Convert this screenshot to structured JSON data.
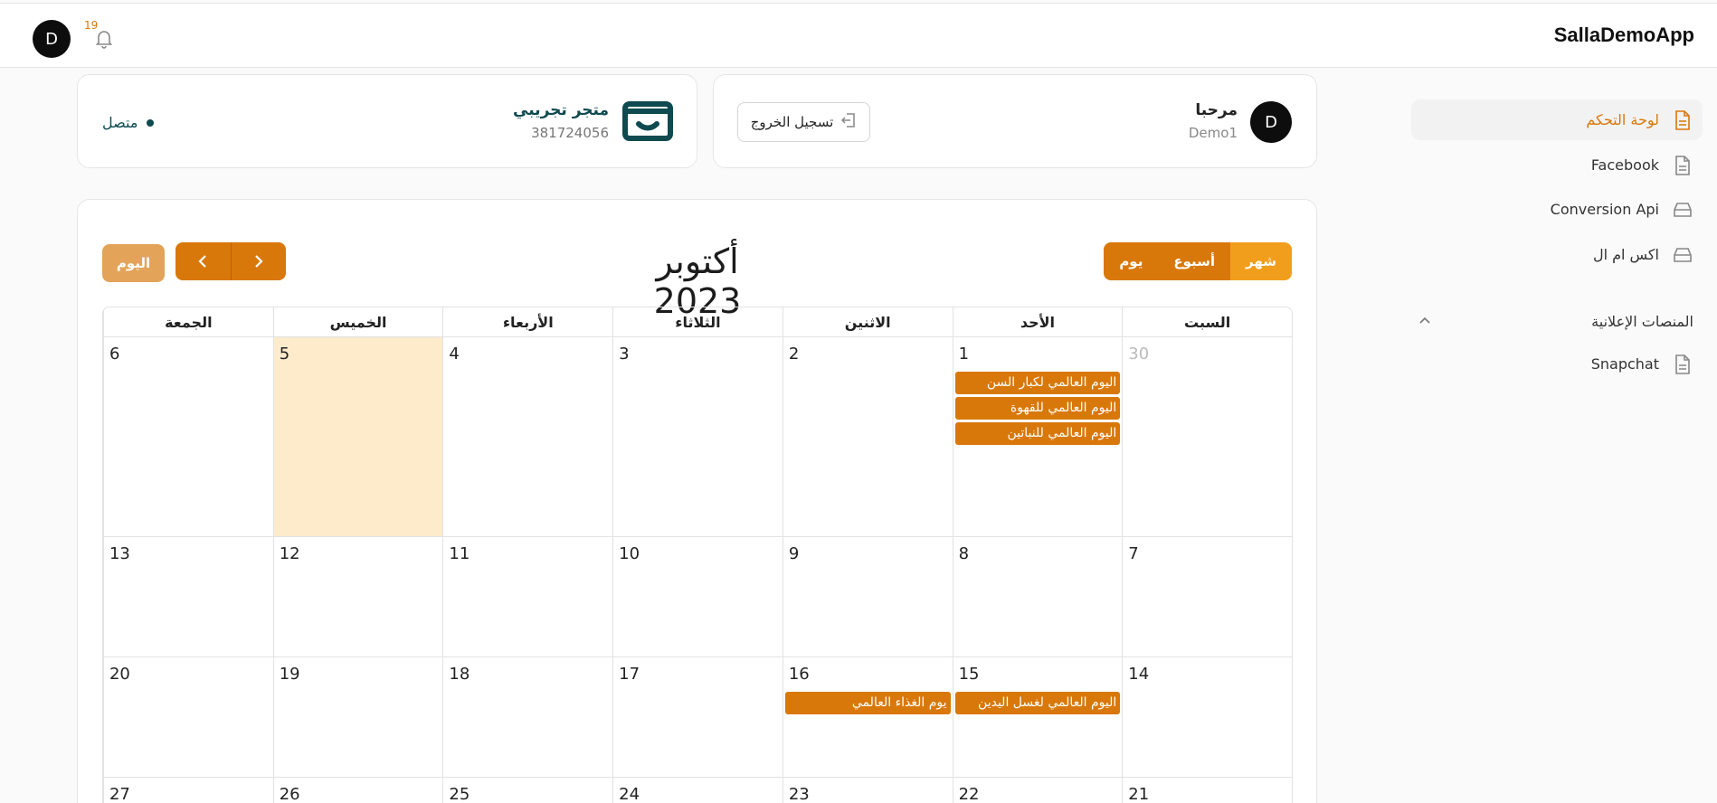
{
  "app": {
    "title": "SallaDemoApp",
    "avatar_letter": "D",
    "notifications_count": "19"
  },
  "sidebar": {
    "items": [
      {
        "label": "لوحة التحكم",
        "icon": "document-icon",
        "active": true
      },
      {
        "label": "Facebook",
        "icon": "document-icon",
        "active": false
      },
      {
        "label": "Conversion Api",
        "icon": "tray-icon",
        "active": false
      },
      {
        "label": "اكس ام ال",
        "icon": "tray-icon",
        "active": false
      }
    ],
    "section": {
      "label": "المنصات الإعلانية",
      "icon": "chevron-up-icon"
    },
    "section_items": [
      {
        "label": "Snapchat",
        "icon": "document-icon"
      }
    ]
  },
  "user_card": {
    "greeting": "مرحبا",
    "name": "Demo1",
    "avatar_letter": "D",
    "logout_label": "تسجيل الخروج"
  },
  "store_card": {
    "name": "متجر تجريبي",
    "id": "381724056",
    "status": "متصل"
  },
  "calendar": {
    "title": "أكتوبر 2023",
    "views": [
      "شهر",
      "أسبوع",
      "يوم"
    ],
    "active_view": "شهر",
    "today_label": "اليوم",
    "weekdays": [
      "السبت",
      "الأحد",
      "الاثنين",
      "الثلاثاء",
      "الأربعاء",
      "الخميس",
      "الجمعة"
    ],
    "weeks": [
      {
        "days": [
          {
            "num": "30",
            "muted": true,
            "events": []
          },
          {
            "num": "1",
            "events": [
              "اليوم العالمي لكبار السن",
              "اليوم العالمي للقهوة",
              "اليوم العالمي للنباتين"
            ]
          },
          {
            "num": "2",
            "events": []
          },
          {
            "num": "3",
            "events": []
          },
          {
            "num": "4",
            "events": []
          },
          {
            "num": "5",
            "today": true,
            "events": []
          },
          {
            "num": "6",
            "events": []
          }
        ]
      },
      {
        "days": [
          {
            "num": "7",
            "events": []
          },
          {
            "num": "8",
            "events": []
          },
          {
            "num": "9",
            "events": []
          },
          {
            "num": "10",
            "events": []
          },
          {
            "num": "11",
            "events": []
          },
          {
            "num": "12",
            "events": []
          },
          {
            "num": "13",
            "events": []
          }
        ]
      },
      {
        "days": [
          {
            "num": "14",
            "events": []
          },
          {
            "num": "15",
            "events": [
              "اليوم العالمي لغسل اليدين"
            ]
          },
          {
            "num": "16",
            "events": [
              "يوم الغذاء العالمي"
            ]
          },
          {
            "num": "17",
            "events": []
          },
          {
            "num": "18",
            "events": []
          },
          {
            "num": "19",
            "events": []
          },
          {
            "num": "20",
            "events": []
          }
        ]
      },
      {
        "days": [
          {
            "num": "21",
            "events": []
          },
          {
            "num": "22",
            "events": []
          },
          {
            "num": "23",
            "events": []
          },
          {
            "num": "24",
            "events": []
          },
          {
            "num": "25",
            "events": []
          },
          {
            "num": "26",
            "events": []
          },
          {
            "num": "27",
            "events": []
          }
        ]
      }
    ]
  },
  "colors": {
    "accent": "#d9780a",
    "accent_light": "#f29e1d",
    "today_bg": "#fdebcc",
    "brand_teal": "#0e4a4f"
  }
}
